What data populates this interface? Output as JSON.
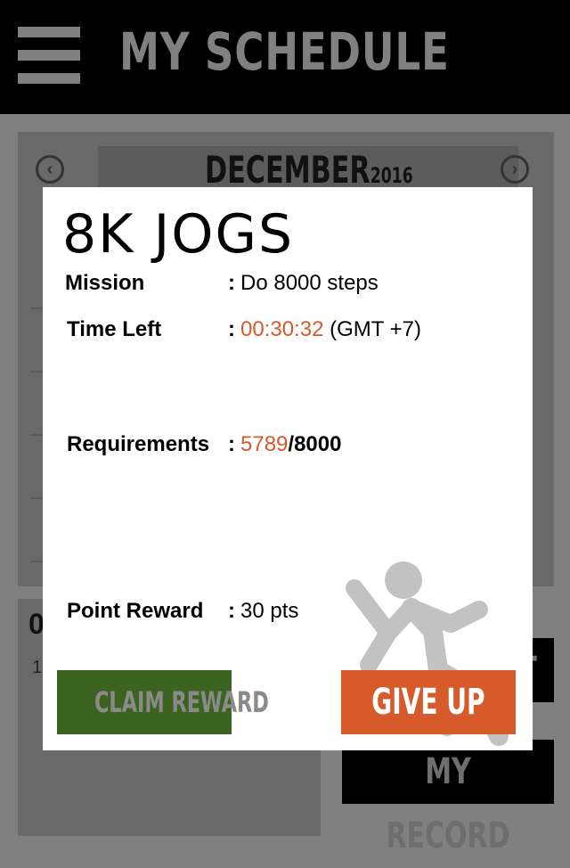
{
  "header": {
    "title": "MY SCHEDULE",
    "menu_icon": "hamburger-menu-icon"
  },
  "calendar": {
    "month": "DECEMBER",
    "year": "2016",
    "prev_icon": "chevron-left-icon",
    "next_icon": "chevron-right-icon"
  },
  "background_panel": {
    "partial_number": "0",
    "partial_text": "1"
  },
  "background_buttons": {
    "top_label": "T",
    "record_label": "MY RECORD"
  },
  "modal": {
    "title": "8K JOGS",
    "mission": {
      "label": "Mission",
      "colon": ":",
      "value": "Do 8000 steps"
    },
    "time_left": {
      "label": "Time Left",
      "colon": ":",
      "time": "00:30:32",
      "timezone": "(GMT +7)"
    },
    "requirements": {
      "label": "Requirements",
      "colon": ":",
      "current": "5789",
      "separator": "/",
      "target": "8000"
    },
    "point_reward": {
      "label": "Point Reward",
      "colon": ":",
      "value": "30 pts"
    },
    "claim_label": "CLAIM REWARD",
    "give_up_label": "GIVE UP",
    "runner_icon": "running-person-icon",
    "accent_color": "#d75a2a",
    "claim_color": "#3d6321"
  }
}
